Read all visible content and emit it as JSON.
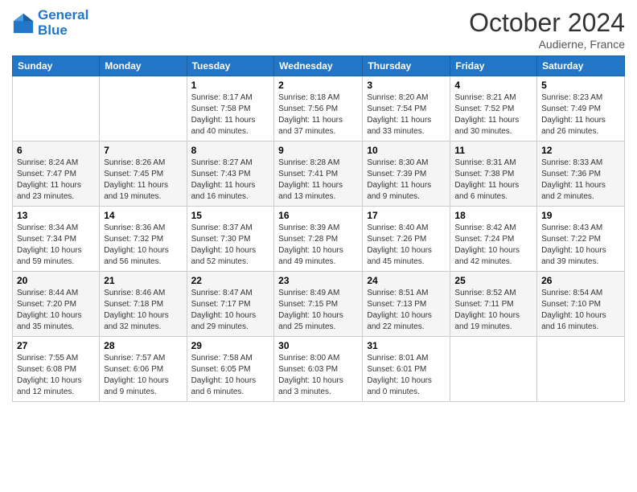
{
  "header": {
    "logo_line1": "General",
    "logo_line2": "Blue",
    "month": "October 2024",
    "location": "Audierne, France"
  },
  "weekdays": [
    "Sunday",
    "Monday",
    "Tuesday",
    "Wednesday",
    "Thursday",
    "Friday",
    "Saturday"
  ],
  "weeks": [
    [
      {
        "day": "",
        "sunrise": "",
        "sunset": "",
        "daylight": ""
      },
      {
        "day": "",
        "sunrise": "",
        "sunset": "",
        "daylight": ""
      },
      {
        "day": "1",
        "sunrise": "Sunrise: 8:17 AM",
        "sunset": "Sunset: 7:58 PM",
        "daylight": "Daylight: 11 hours and 40 minutes."
      },
      {
        "day": "2",
        "sunrise": "Sunrise: 8:18 AM",
        "sunset": "Sunset: 7:56 PM",
        "daylight": "Daylight: 11 hours and 37 minutes."
      },
      {
        "day": "3",
        "sunrise": "Sunrise: 8:20 AM",
        "sunset": "Sunset: 7:54 PM",
        "daylight": "Daylight: 11 hours and 33 minutes."
      },
      {
        "day": "4",
        "sunrise": "Sunrise: 8:21 AM",
        "sunset": "Sunset: 7:52 PM",
        "daylight": "Daylight: 11 hours and 30 minutes."
      },
      {
        "day": "5",
        "sunrise": "Sunrise: 8:23 AM",
        "sunset": "Sunset: 7:49 PM",
        "daylight": "Daylight: 11 hours and 26 minutes."
      }
    ],
    [
      {
        "day": "6",
        "sunrise": "Sunrise: 8:24 AM",
        "sunset": "Sunset: 7:47 PM",
        "daylight": "Daylight: 11 hours and 23 minutes."
      },
      {
        "day": "7",
        "sunrise": "Sunrise: 8:26 AM",
        "sunset": "Sunset: 7:45 PM",
        "daylight": "Daylight: 11 hours and 19 minutes."
      },
      {
        "day": "8",
        "sunrise": "Sunrise: 8:27 AM",
        "sunset": "Sunset: 7:43 PM",
        "daylight": "Daylight: 11 hours and 16 minutes."
      },
      {
        "day": "9",
        "sunrise": "Sunrise: 8:28 AM",
        "sunset": "Sunset: 7:41 PM",
        "daylight": "Daylight: 11 hours and 13 minutes."
      },
      {
        "day": "10",
        "sunrise": "Sunrise: 8:30 AM",
        "sunset": "Sunset: 7:39 PM",
        "daylight": "Daylight: 11 hours and 9 minutes."
      },
      {
        "day": "11",
        "sunrise": "Sunrise: 8:31 AM",
        "sunset": "Sunset: 7:38 PM",
        "daylight": "Daylight: 11 hours and 6 minutes."
      },
      {
        "day": "12",
        "sunrise": "Sunrise: 8:33 AM",
        "sunset": "Sunset: 7:36 PM",
        "daylight": "Daylight: 11 hours and 2 minutes."
      }
    ],
    [
      {
        "day": "13",
        "sunrise": "Sunrise: 8:34 AM",
        "sunset": "Sunset: 7:34 PM",
        "daylight": "Daylight: 10 hours and 59 minutes."
      },
      {
        "day": "14",
        "sunrise": "Sunrise: 8:36 AM",
        "sunset": "Sunset: 7:32 PM",
        "daylight": "Daylight: 10 hours and 56 minutes."
      },
      {
        "day": "15",
        "sunrise": "Sunrise: 8:37 AM",
        "sunset": "Sunset: 7:30 PM",
        "daylight": "Daylight: 10 hours and 52 minutes."
      },
      {
        "day": "16",
        "sunrise": "Sunrise: 8:39 AM",
        "sunset": "Sunset: 7:28 PM",
        "daylight": "Daylight: 10 hours and 49 minutes."
      },
      {
        "day": "17",
        "sunrise": "Sunrise: 8:40 AM",
        "sunset": "Sunset: 7:26 PM",
        "daylight": "Daylight: 10 hours and 45 minutes."
      },
      {
        "day": "18",
        "sunrise": "Sunrise: 8:42 AM",
        "sunset": "Sunset: 7:24 PM",
        "daylight": "Daylight: 10 hours and 42 minutes."
      },
      {
        "day": "19",
        "sunrise": "Sunrise: 8:43 AM",
        "sunset": "Sunset: 7:22 PM",
        "daylight": "Daylight: 10 hours and 39 minutes."
      }
    ],
    [
      {
        "day": "20",
        "sunrise": "Sunrise: 8:44 AM",
        "sunset": "Sunset: 7:20 PM",
        "daylight": "Daylight: 10 hours and 35 minutes."
      },
      {
        "day": "21",
        "sunrise": "Sunrise: 8:46 AM",
        "sunset": "Sunset: 7:18 PM",
        "daylight": "Daylight: 10 hours and 32 minutes."
      },
      {
        "day": "22",
        "sunrise": "Sunrise: 8:47 AM",
        "sunset": "Sunset: 7:17 PM",
        "daylight": "Daylight: 10 hours and 29 minutes."
      },
      {
        "day": "23",
        "sunrise": "Sunrise: 8:49 AM",
        "sunset": "Sunset: 7:15 PM",
        "daylight": "Daylight: 10 hours and 25 minutes."
      },
      {
        "day": "24",
        "sunrise": "Sunrise: 8:51 AM",
        "sunset": "Sunset: 7:13 PM",
        "daylight": "Daylight: 10 hours and 22 minutes."
      },
      {
        "day": "25",
        "sunrise": "Sunrise: 8:52 AM",
        "sunset": "Sunset: 7:11 PM",
        "daylight": "Daylight: 10 hours and 19 minutes."
      },
      {
        "day": "26",
        "sunrise": "Sunrise: 8:54 AM",
        "sunset": "Sunset: 7:10 PM",
        "daylight": "Daylight: 10 hours and 16 minutes."
      }
    ],
    [
      {
        "day": "27",
        "sunrise": "Sunrise: 7:55 AM",
        "sunset": "Sunset: 6:08 PM",
        "daylight": "Daylight: 10 hours and 12 minutes."
      },
      {
        "day": "28",
        "sunrise": "Sunrise: 7:57 AM",
        "sunset": "Sunset: 6:06 PM",
        "daylight": "Daylight: 10 hours and 9 minutes."
      },
      {
        "day": "29",
        "sunrise": "Sunrise: 7:58 AM",
        "sunset": "Sunset: 6:05 PM",
        "daylight": "Daylight: 10 hours and 6 minutes."
      },
      {
        "day": "30",
        "sunrise": "Sunrise: 8:00 AM",
        "sunset": "Sunset: 6:03 PM",
        "daylight": "Daylight: 10 hours and 3 minutes."
      },
      {
        "day": "31",
        "sunrise": "Sunrise: 8:01 AM",
        "sunset": "Sunset: 6:01 PM",
        "daylight": "Daylight: 10 hours and 0 minutes."
      },
      {
        "day": "",
        "sunrise": "",
        "sunset": "",
        "daylight": ""
      },
      {
        "day": "",
        "sunrise": "",
        "sunset": "",
        "daylight": ""
      }
    ]
  ]
}
